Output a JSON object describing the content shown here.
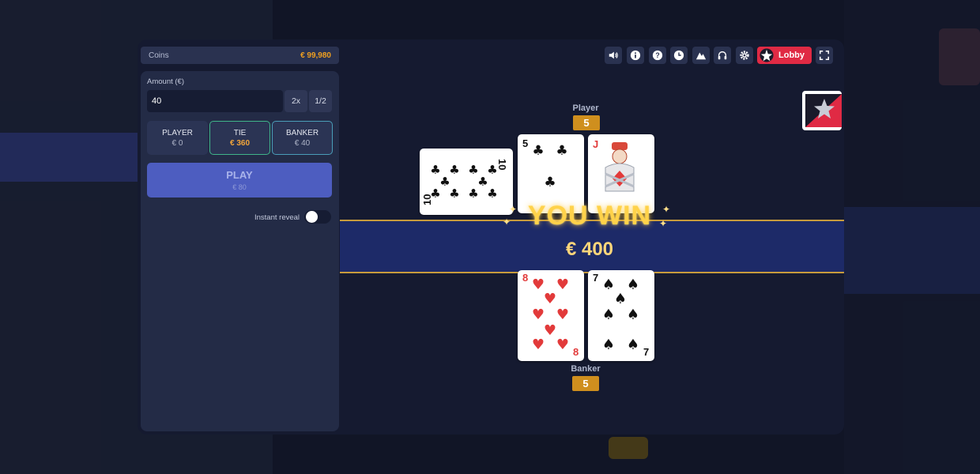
{
  "coins": {
    "label": "Coins",
    "value": "€ 99,980"
  },
  "bet": {
    "amount_label": "Amount (€)",
    "amount_value": "40",
    "double_label": "2x",
    "half_label": "1/2",
    "options": [
      {
        "label": "PLAYER",
        "value": "€ 0"
      },
      {
        "label": "TIE",
        "value": "€ 360"
      },
      {
        "label": "BANKER",
        "value": "€ 40"
      }
    ],
    "play_label": "PLAY",
    "play_value": "€ 80",
    "instant_reveal_label": "Instant reveal",
    "instant_reveal_on": false
  },
  "toolbar": {
    "icons": [
      "volume-icon",
      "info-icon",
      "help-icon",
      "history-icon",
      "provably-fair-icon",
      "support-icon",
      "settings-icon"
    ],
    "lobby_label": "Lobby",
    "fullscreen_icon": "fullscreen-icon"
  },
  "table": {
    "player": {
      "label": "Player",
      "score": "5",
      "cards": [
        {
          "rank": "10",
          "suit": "clubs"
        },
        {
          "rank": "5",
          "suit": "clubs"
        },
        {
          "rank": "J",
          "suit": "diamonds"
        }
      ]
    },
    "banker": {
      "label": "Banker",
      "score": "5",
      "cards": [
        {
          "rank": "8",
          "suit": "hearts"
        },
        {
          "rank": "7",
          "suit": "spades"
        }
      ]
    }
  },
  "result": {
    "title": "YOU WIN",
    "amount": "€ 400"
  },
  "colors": {
    "accent_gold": "#cf8f1e",
    "lobby_red": "#e02a44",
    "play_blue": "#4d5dc0",
    "coins_orange": "#f0a020"
  }
}
